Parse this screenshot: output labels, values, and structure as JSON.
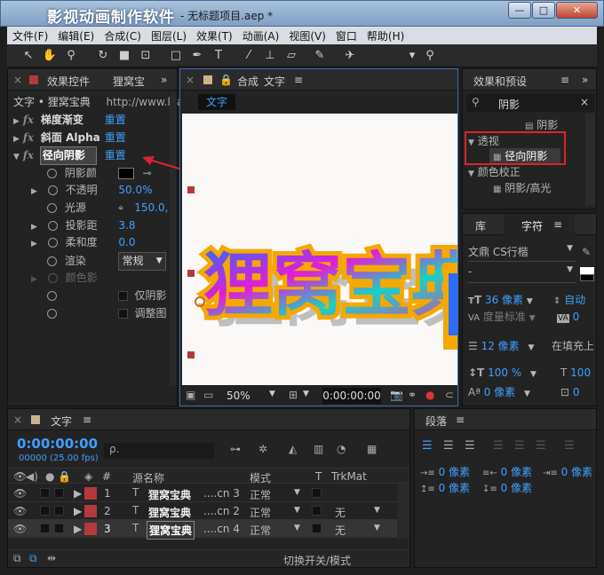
{
  "window": {
    "title": "影视动画制作软件",
    "subtitle": "- 无标题项目.aep *",
    "min": "—",
    "max": "□",
    "close": "✕"
  },
  "menu": [
    "文件(F)",
    "编辑(E)",
    "合成(C)",
    "图层(L)",
    "效果(T)",
    "动画(A)",
    "视图(V)",
    "窗口",
    "帮助(H)"
  ],
  "effect_controls": {
    "tab_label": "效果控件",
    "tab_target": "狸窝宝",
    "header_left": "文字 • 狸窝宝典",
    "header_right": "http://www.leawo",
    "effects": [
      {
        "name": "梯度渐变",
        "reset": "重置"
      },
      {
        "name": "斜面 Alpha",
        "reset": "重置"
      },
      {
        "name": "径向阴影",
        "reset": "重置"
      }
    ],
    "properties": [
      {
        "name": "阴影颜",
        "value": ""
      },
      {
        "name": "不透明",
        "value": "50.0%"
      },
      {
        "name": "光源",
        "value": "150.0,"
      },
      {
        "name": "投影距",
        "value": "3.8"
      },
      {
        "name": "柔和度",
        "value": "0.0"
      },
      {
        "name": "渲染",
        "value": "常规"
      },
      {
        "name": "颜色影",
        "value": ""
      },
      {
        "name": "",
        "value": "仅阴影"
      },
      {
        "name": "",
        "value": "调整图"
      }
    ]
  },
  "composition": {
    "tab_label": "合成",
    "tab_target": "文字",
    "subtab": "文字",
    "canvas_text": "狸窝宝典",
    "zoom": "50%",
    "timecode": "0:00:00:00"
  },
  "effects_presets": {
    "tab_label": "效果和预设",
    "search_value": "阴影",
    "tree": [
      {
        "label": "阴影",
        "indent": 2
      },
      {
        "label": "透视",
        "indent": 0,
        "group": true
      },
      {
        "label": "径向阴影",
        "indent": 2,
        "highlight": true
      },
      {
        "label": "颜色校正",
        "indent": 0,
        "group": true
      },
      {
        "label": "阴影/高光",
        "indent": 2
      }
    ]
  },
  "character": {
    "tab_lib": "库",
    "tab_char": "字符",
    "font": "文鼎 CS行楷",
    "style": "-",
    "size": "36 像素",
    "leading": "自动",
    "kerning": "度量标准",
    "tracking": "0",
    "stroke": "12 像素",
    "stroke_mode": "在填充上",
    "vscale": "100 %",
    "hscale": "100",
    "baseline": "0 像素",
    "tsume": "0"
  },
  "paragraph": {
    "tab_label": "段落",
    "indent_left": "0 像素",
    "indent_right": "0 像素",
    "indent_first": "0 像素",
    "space_before": "0 像素",
    "space_after": "0 像素"
  },
  "timeline": {
    "tab_label": "文字",
    "timecode": "0:00:00:00",
    "fps": "00000 (25.00 fps)",
    "search_placeholder": "ρ.",
    "col_num": "#",
    "col_name": "源名称",
    "col_mode": "模式",
    "col_t": "T",
    "col_trkmat": "TrkMat",
    "layers": [
      {
        "num": "1",
        "name": "狸窝宝典",
        "suffix": "....cn 3",
        "mode": "正常",
        "trkmat": ""
      },
      {
        "num": "2",
        "name": "狸窝宝典",
        "suffix": "....cn 2",
        "mode": "正常",
        "trkmat": "无"
      },
      {
        "num": "3",
        "name": "狸窝宝典",
        "suffix": "....cn 4",
        "mode": "正常",
        "trkmat": "无"
      }
    ],
    "footer": "切换开关/模式"
  },
  "colors": {
    "accent": "#3ea0ff",
    "highlight_box": "#d9252a",
    "arrow": "#d9252a",
    "layer_label": "#b43a3a"
  }
}
